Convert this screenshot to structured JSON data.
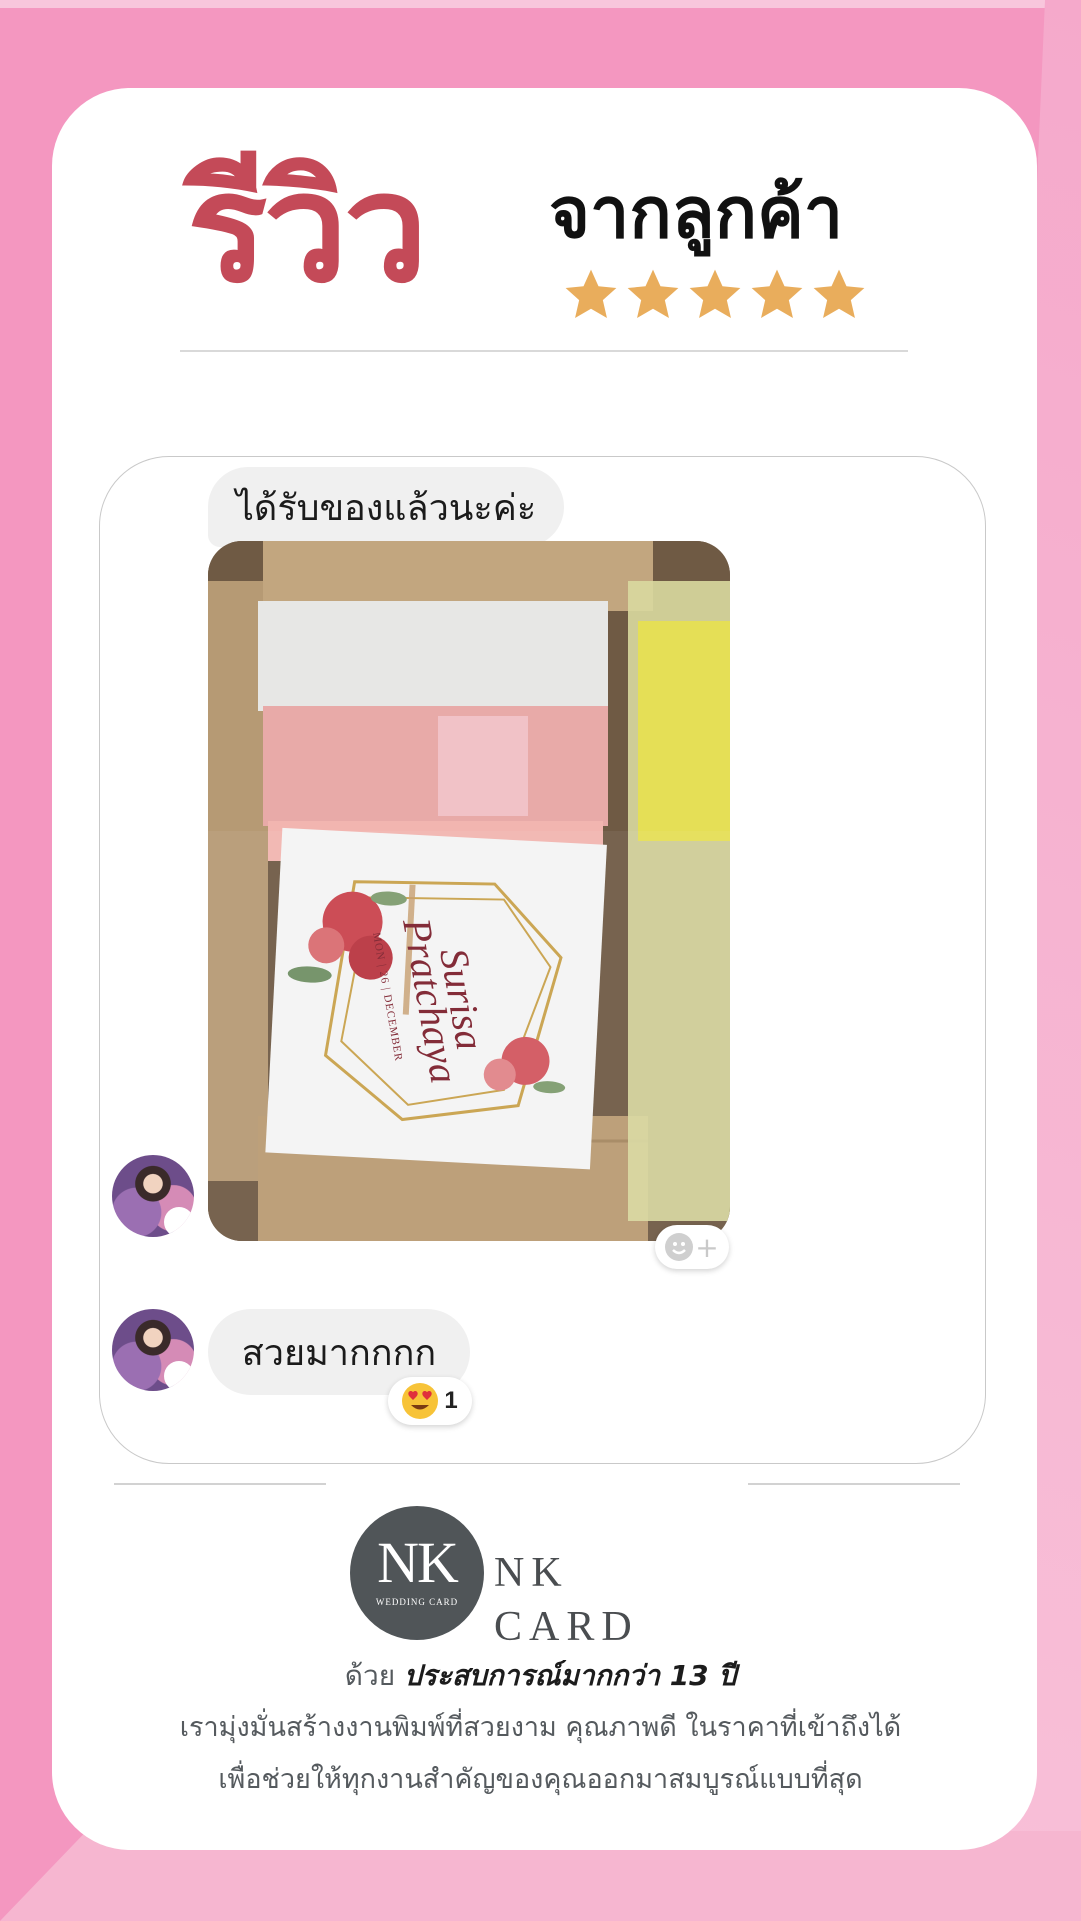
{
  "header": {
    "title_main": "รีวิว",
    "title_sub": "จากลูกค้า",
    "rating_stars": 5,
    "star_color": "#e9ad5c",
    "title_color": "#c44a58"
  },
  "chat": {
    "message_1": "ได้รับของแล้วนะค่ะ",
    "photo": {
      "invite_name_1": "Surisa",
      "invite_name_2": "Pratchaya",
      "invite_day": "MON",
      "invite_date": "26",
      "invite_month": "DECEMBER"
    },
    "add_reaction_icon": "smile-plus-icon",
    "message_2": "สวยมากกกก",
    "reaction_emoji": "heart-eyes-icon",
    "reaction_count": "1"
  },
  "brand": {
    "logo_mark": "NK",
    "logo_small": "WEDDING CARD",
    "name": "NK CARD"
  },
  "tagline": {
    "prefix": "ด้วย",
    "highlight": "ประสบการณ์มากกว่า 13 ปี",
    "line_2": "เรามุ่งมั่นสร้างงานพิมพ์ที่สวยงาม คุณภาพดี ในราคาที่เข้าถึงได้",
    "line_3": "เพื่อช่วยให้ทุกงานสำคัญของคุณออกมาสมบูรณ์แบบที่สุด"
  }
}
